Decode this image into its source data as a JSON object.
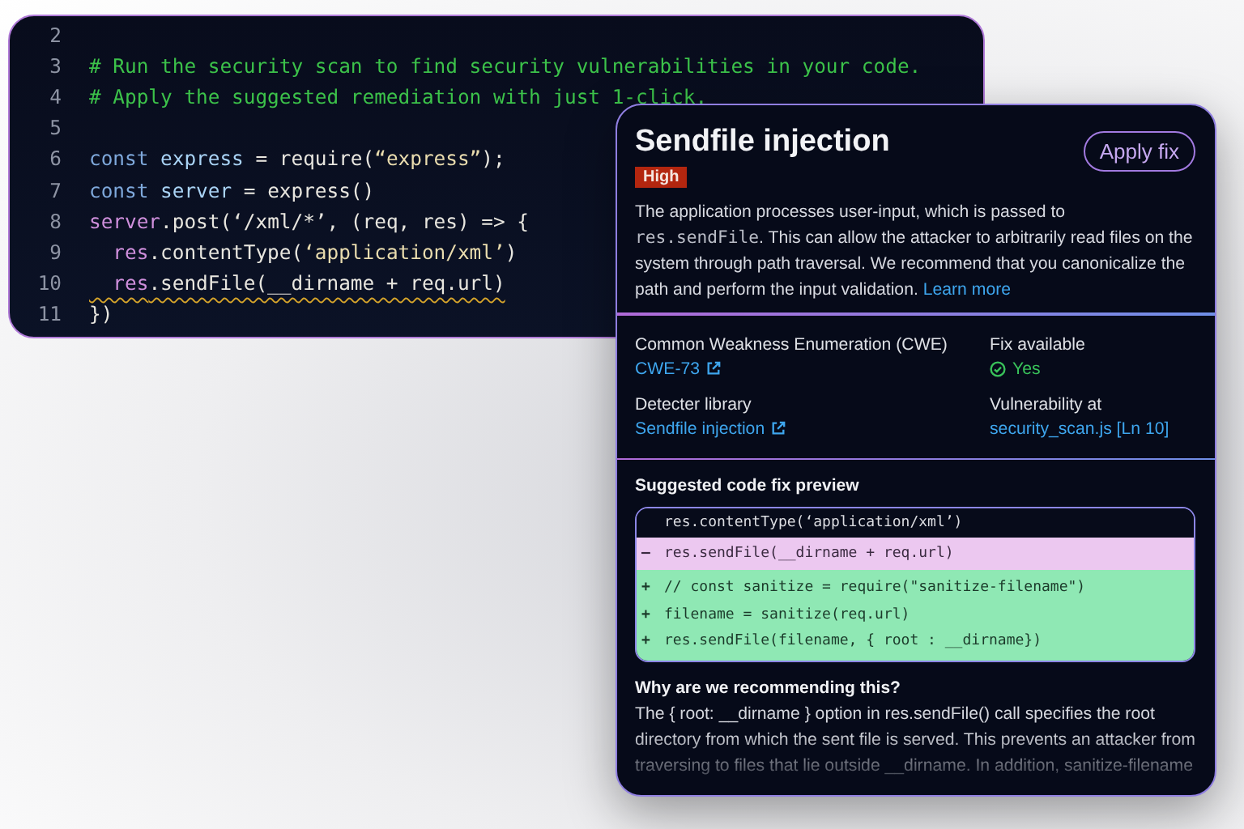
{
  "editor": {
    "lines": [
      {
        "number": "2"
      },
      {
        "number": "3",
        "tokens": [
          {
            "text": "# Run the security scan to find security vulnerabilities in your code.",
            "kind": "comment"
          }
        ]
      },
      {
        "number": "4",
        "tokens": [
          {
            "text": "# Apply the suggested remediation with just 1-click.",
            "kind": "comment"
          }
        ]
      },
      {
        "number": "5"
      },
      {
        "number": "6",
        "tokens": [
          {
            "text": "const",
            "kind": "keyword"
          },
          {
            "text": " express",
            "kind": "variable"
          },
          {
            "text": " = require(",
            "kind": "plain"
          },
          {
            "text": "“express”",
            "kind": "string"
          },
          {
            "text": ");",
            "kind": "plain"
          }
        ]
      },
      {
        "number": "7",
        "tokens": [
          {
            "text": "const",
            "kind": "keyword"
          },
          {
            "text": " server",
            "kind": "variable"
          },
          {
            "text": " = express()",
            "kind": "plain"
          }
        ]
      },
      {
        "number": "8",
        "tokens": [
          {
            "text": "server",
            "kind": "member"
          },
          {
            "text": ".post(‘/xml/*’, (req, res) => {",
            "kind": "plain"
          }
        ]
      },
      {
        "number": "9",
        "tokens": [
          {
            "text": "  res",
            "kind": "member"
          },
          {
            "text": ".contentType(",
            "kind": "plain"
          },
          {
            "text": "‘application/xml’",
            "kind": "string"
          },
          {
            "text": ")",
            "kind": "plain"
          }
        ]
      },
      {
        "number": "10",
        "warning": true,
        "tokens": [
          {
            "text": "  res",
            "kind": "member"
          },
          {
            "text": ".sendFile(__dirname + req.url)",
            "kind": "plain"
          }
        ]
      },
      {
        "number": "11",
        "tokens": [
          {
            "text": "})",
            "kind": "plain"
          }
        ]
      }
    ]
  },
  "finding": {
    "title": "Sendfile injection",
    "severity": "High",
    "apply_button": "Apply fix",
    "description": [
      {
        "text": "The application processes user-input, which is passed to ",
        "kind": "text"
      },
      {
        "text": "res.sendFile",
        "kind": "code"
      },
      {
        "text": ". This can allow the attacker to arbitrarily read files on the system through path traversal. We recommend that you canonicalize the path and perform the input validation. ",
        "kind": "text"
      },
      {
        "text": "Learn more",
        "kind": "link"
      }
    ],
    "details": [
      {
        "label": "Common Weakness Enumeration (CWE)",
        "value": "CWE-73",
        "kind": "external_link"
      },
      {
        "label": "Fix available",
        "value": "Yes",
        "kind": "status"
      },
      {
        "label": "Detecter library",
        "value": "Sendfile injection",
        "kind": "external_link"
      },
      {
        "label": "Vulnerability at",
        "value": "security_scan.js [Ln 10]",
        "kind": "link"
      }
    ],
    "fix_preview": {
      "title": "Suggested code fix preview",
      "lines": [
        {
          "kind": "context",
          "text": "res.contentType(‘application/xml’)"
        },
        {
          "kind": "removed",
          "marker": "–",
          "text": "res.sendFile(__dirname + req.url)"
        },
        {
          "kind": "added",
          "marker": "+",
          "text": "// const sanitize = require(\"sanitize-filename\")"
        },
        {
          "kind": "added",
          "marker": "+",
          "text": "filename = sanitize(req.url)"
        },
        {
          "kind": "added",
          "marker": "+",
          "text": "res.sendFile(filename, { root : __dirname})"
        }
      ]
    },
    "why": {
      "title": "Why are we recommending this?",
      "text": "The { root: __dirname } option in res.sendFile() call specifies the root directory from which the sent file is served. This prevents an attacker from traversing to files that lie outside __dirname. In addition, sanitize-filename"
    }
  }
}
